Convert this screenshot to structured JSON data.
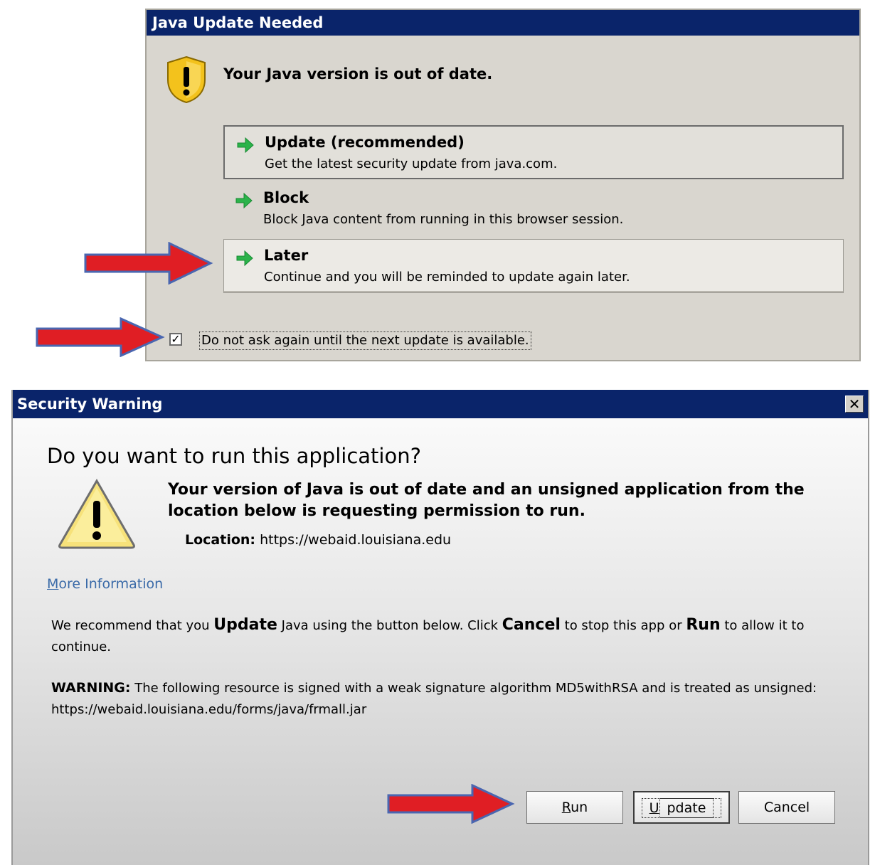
{
  "update_dialog": {
    "title": "Java Update Needed",
    "headline": "Your Java version is out of date.",
    "options": [
      {
        "title": "Update (recommended)",
        "desc": "Get the latest security update from java.com."
      },
      {
        "title": "Block",
        "desc": "Block Java content from running in this browser session."
      },
      {
        "title": "Later",
        "desc": "Continue and you will be reminded to update again later."
      }
    ],
    "checkbox": {
      "label": "Do not ask again until the next update is available.",
      "checked": "✓"
    }
  },
  "security_dialog": {
    "title": "Security Warning",
    "close_glyph": "✕",
    "question": "Do you want to run this application?",
    "warning_text": "Your version of Java is out of date and an unsigned application from the location below is requesting permission to run.",
    "location_label": "Location:",
    "location_value": "https://webaid.louisiana.edu",
    "more_info": "More Information",
    "recommend": {
      "p1": "We recommend that you ",
      "update": "Update",
      "p2": " Java using the button below. Click ",
      "cancel": "Cancel",
      "p3": " to stop this app or ",
      "run": "Run",
      "p4": " to allow it to continue."
    },
    "warning": {
      "label": "WARNING:",
      "text": " The following resource is signed with a weak signature algorithm MD5withRSA and is treated as unsigned: https://webaid.louisiana.edu/forms/java/frmall.jar"
    },
    "buttons": {
      "run": "Run",
      "update": "Update",
      "cancel": "Cancel"
    }
  },
  "colors": {
    "titlebar": "#0a246a",
    "annotation_arrow": "#e01e24",
    "go_arrow": "#2bb34a"
  }
}
